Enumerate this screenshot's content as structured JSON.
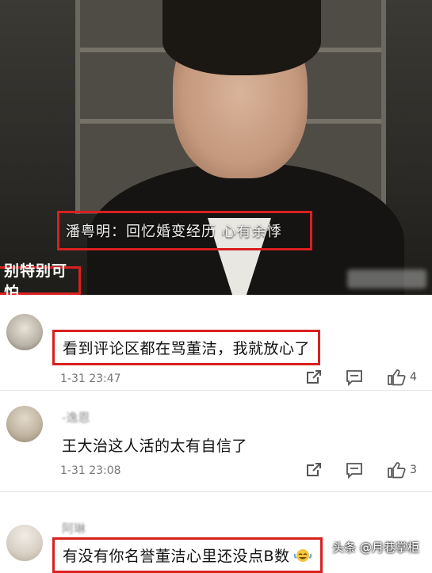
{
  "video": {
    "subtitle": "潘粤明：回忆婚变经历 心有余悸",
    "caption": "别特别可怕"
  },
  "comments": [
    {
      "username": "",
      "text": "看到评论区都在骂董洁，我就放心了",
      "time": "1-31 23:47",
      "likes": "4",
      "highlighted": true
    },
    {
      "username": "-逸恩",
      "text": "王大治这人活的太有自信了",
      "time": "1-31 23:08",
      "likes": "3",
      "highlighted": false
    },
    {
      "username": "阿琳",
      "text": "有没有你名誉董洁心里还没点B数",
      "highlighted": true,
      "emoji": "laughing-emoji"
    }
  ],
  "watermark": "头条 @月巷掌柜",
  "colors": {
    "highlight": "#d8201f",
    "icon": "#555555",
    "time": "#777777"
  }
}
